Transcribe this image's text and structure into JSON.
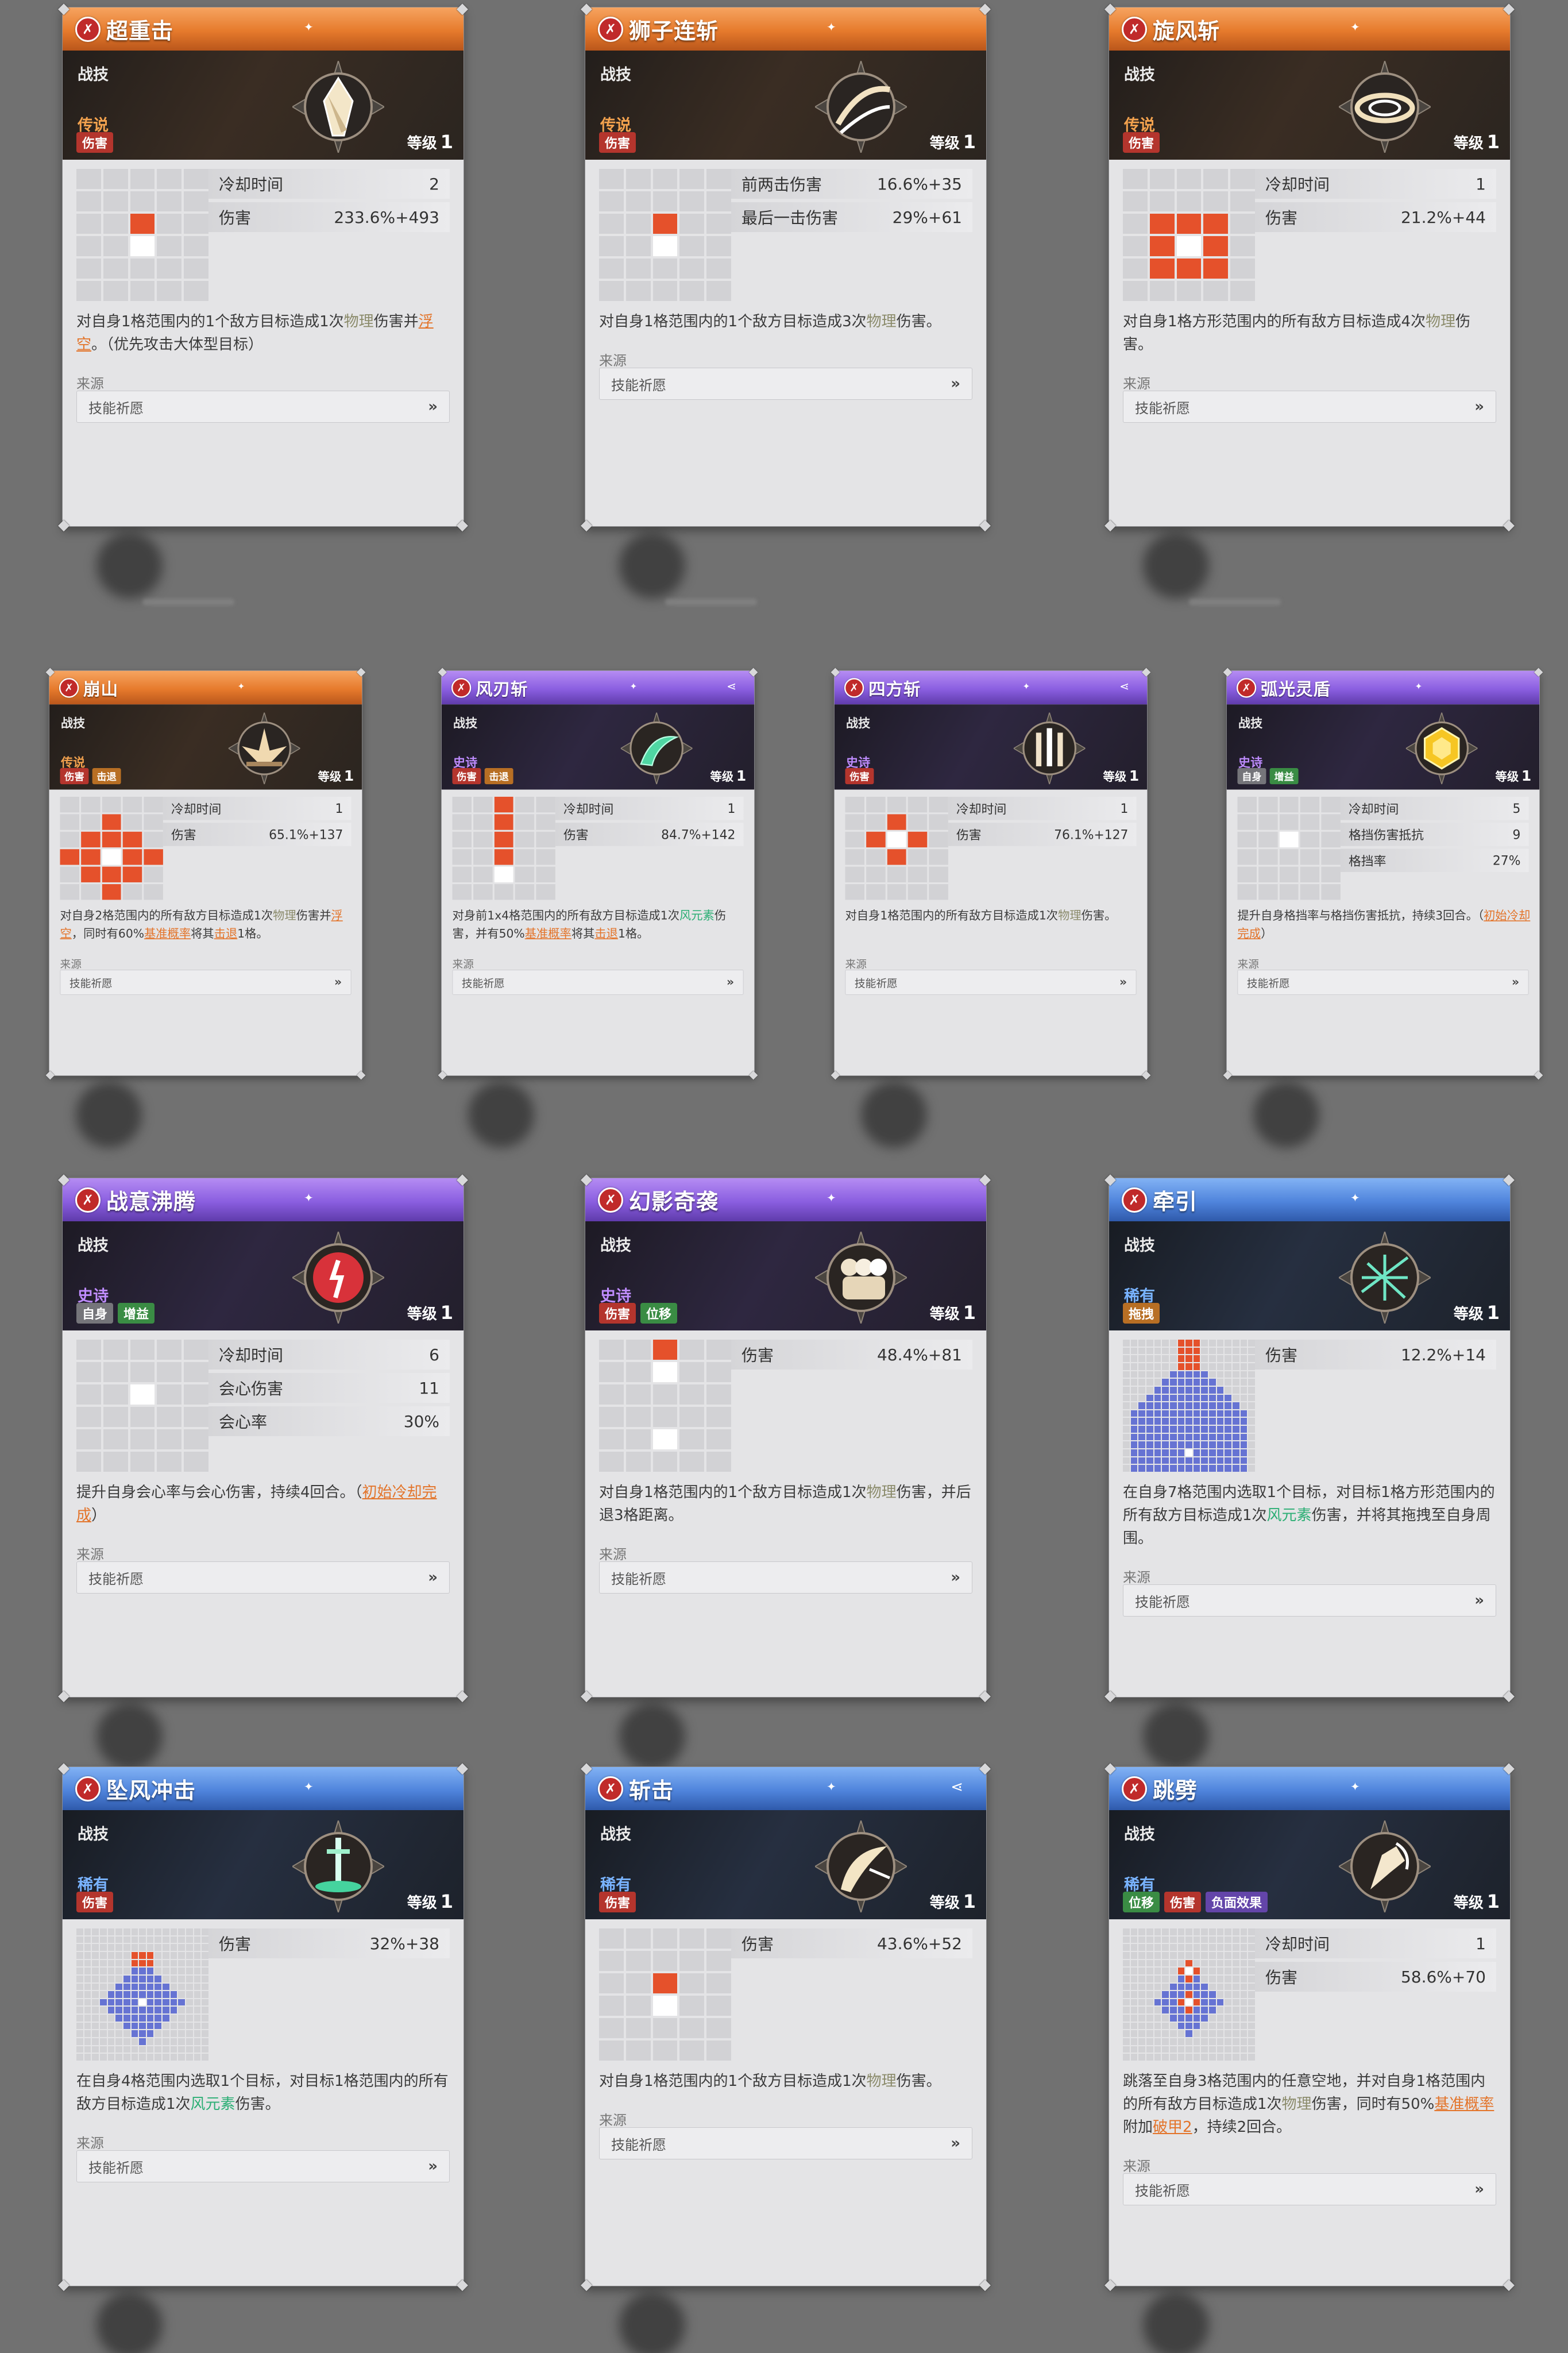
{
  "source_label": "来源",
  "level_label": "等级",
  "source_button_label": "技能祈愿",
  "chevron_glyph": "»",
  "cards": [
    {
      "title": "超重击",
      "type": "战技",
      "rarity": "传说",
      "rarity_key": "legend",
      "level": "1",
      "tags": [
        {
          "label": "伤害",
          "color": "red"
        }
      ],
      "stats": [
        {
          "label": "冷却时间",
          "value": "2"
        },
        {
          "label": "伤害",
          "value": "233.6%+493"
        }
      ],
      "desc": [
        {
          "t": "对自身1格范围内的1个敌方目标造成1次"
        },
        {
          "t": "物理",
          "c": "gray"
        },
        {
          "t": "伤害并"
        },
        {
          "t": "浮空",
          "c": "orange"
        },
        {
          "t": "。（优先攻击大体型目标）"
        }
      ],
      "icon": "crystal-shard-icon",
      "grid": [
        ".....",
        ".....",
        "..r..",
        "..w..",
        ".....",
        "....."
      ]
    },
    {
      "title": "狮子连斩",
      "type": "战技",
      "rarity": "传说",
      "rarity_key": "legend",
      "level": "1",
      "tags": [
        {
          "label": "伤害",
          "color": "red"
        }
      ],
      "stats": [
        {
          "label": "前两击伤害",
          "value": "16.6%+35"
        },
        {
          "label": "最后一击伤害",
          "value": "29%+61"
        }
      ],
      "desc": [
        {
          "t": "对自身1格范围内的1个敌方目标造成3次"
        },
        {
          "t": "物理",
          "c": "gray"
        },
        {
          "t": "伤害。"
        }
      ],
      "icon": "slash-arc-icon",
      "grid": [
        ".....",
        ".....",
        "..r..",
        "..w..",
        ".....",
        "....."
      ]
    },
    {
      "title": "旋风斩",
      "type": "战技",
      "rarity": "传说",
      "rarity_key": "legend",
      "level": "1",
      "tags": [
        {
          "label": "伤害",
          "color": "red"
        }
      ],
      "stats": [
        {
          "label": "冷却时间",
          "value": "1"
        },
        {
          "label": "伤害",
          "value": "21.2%+44"
        }
      ],
      "desc": [
        {
          "t": "对自身1格方形范围内的所有敌方目标造成4次"
        },
        {
          "t": "物理",
          "c": "gray"
        },
        {
          "t": "伤害。"
        }
      ],
      "icon": "whirlwind-icon",
      "grid": [
        ".....",
        ".....",
        ".rrr.",
        ".rwr.",
        ".rrr.",
        "....."
      ]
    },
    {
      "title": "崩山",
      "type": "战技",
      "rarity": "传说",
      "rarity_key": "legend",
      "level": "1",
      "tags": [
        {
          "label": "伤害",
          "color": "red"
        },
        {
          "label": "击退",
          "color": "orange"
        }
      ],
      "stats": [
        {
          "label": "冷却时间",
          "value": "1"
        },
        {
          "label": "伤害",
          "value": "65.1%+137"
        }
      ],
      "desc": [
        {
          "t": "对自身2格范围内的所有敌方目标造成1次"
        },
        {
          "t": "物理",
          "c": "gray"
        },
        {
          "t": "伤害并"
        },
        {
          "t": "浮空",
          "c": "orange"
        },
        {
          "t": "，同时有60%"
        },
        {
          "t": "基准概率",
          "c": "orange"
        },
        {
          "t": "将其"
        },
        {
          "t": "击退",
          "c": "orange"
        },
        {
          "t": "1格。"
        }
      ],
      "icon": "ground-burst-icon",
      "grid": [
        ".....",
        "..r..",
        ".rrr.",
        "rrwrr",
        ".rrr.",
        "..r.."
      ]
    },
    {
      "title": "风刃斩",
      "type": "战技",
      "rarity": "史诗",
      "rarity_key": "epic",
      "level": "1",
      "share": true,
      "tags": [
        {
          "label": "伤害",
          "color": "red"
        },
        {
          "label": "击退",
          "color": "orange"
        }
      ],
      "stats": [
        {
          "label": "冷却时间",
          "value": "1"
        },
        {
          "label": "伤害",
          "value": "84.7%+142"
        }
      ],
      "desc": [
        {
          "t": "对身前1x4格范围内的所有敌方目标造成1次"
        },
        {
          "t": "风元素",
          "c": "green"
        },
        {
          "t": "伤害，并有50%"
        },
        {
          "t": "基准概率",
          "c": "orange"
        },
        {
          "t": "将其"
        },
        {
          "t": "击退",
          "c": "orange"
        },
        {
          "t": "1格。"
        }
      ],
      "icon": "wind-blade-icon",
      "grid": [
        "..r..",
        "..r..",
        "..r..",
        "..r..",
        "..w..",
        "....."
      ]
    },
    {
      "title": "四方斩",
      "type": "战技",
      "rarity": "史诗",
      "rarity_key": "epic",
      "level": "1",
      "share": true,
      "tags": [
        {
          "label": "伤害",
          "color": "red"
        }
      ],
      "stats": [
        {
          "label": "冷却时间",
          "value": "1"
        },
        {
          "label": "伤害",
          "value": "76.1%+127"
        }
      ],
      "desc": [
        {
          "t": "对自身1格范围内的所有敌方目标造成1次"
        },
        {
          "t": "物理",
          "c": "gray"
        },
        {
          "t": "伤害。"
        }
      ],
      "icon": "four-blades-icon",
      "grid": [
        ".....",
        "..r..",
        ".rwr.",
        "..r..",
        ".....",
        "....."
      ]
    },
    {
      "title": "弧光灵盾",
      "type": "战技",
      "rarity": "史诗",
      "rarity_key": "epic",
      "level": "1",
      "tags": [
        {
          "label": "自身",
          "color": "gray"
        },
        {
          "label": "增益",
          "color": "green"
        }
      ],
      "stats": [
        {
          "label": "冷却时间",
          "value": "5"
        },
        {
          "label": "格挡伤害抵抗",
          "value": "9"
        },
        {
          "label": "格挡率",
          "value": "27%"
        }
      ],
      "desc": [
        {
          "t": "提升自身格挡率与格挡伤害抵抗，持续3回合。（"
        },
        {
          "t": "初始冷却完成",
          "c": "orange"
        },
        {
          "t": "）"
        }
      ],
      "icon": "golden-shield-icon",
      "grid": [
        ".....",
        ".....",
        "..w..",
        ".....",
        ".....",
        "....."
      ]
    },
    {
      "title": "战意沸腾",
      "type": "战技",
      "rarity": "史诗",
      "rarity_key": "epic",
      "level": "1",
      "tags": [
        {
          "label": "自身",
          "color": "gray"
        },
        {
          "label": "增益",
          "color": "green"
        }
      ],
      "stats": [
        {
          "label": "冷却时间",
          "value": "6"
        },
        {
          "label": "会心伤害",
          "value": "11"
        },
        {
          "label": "会心率",
          "value": "30%"
        }
      ],
      "desc": [
        {
          "t": "提升自身会心率与会心伤害，持续4回合。（"
        },
        {
          "t": "初始冷却完成",
          "c": "orange"
        },
        {
          "t": "）"
        }
      ],
      "icon": "fury-aura-icon",
      "grid": [
        ".....",
        ".....",
        "..w..",
        ".....",
        ".....",
        "....."
      ]
    },
    {
      "title": "幻影奇袭",
      "type": "战技",
      "rarity": "史诗",
      "rarity_key": "epic",
      "level": "1",
      "tags": [
        {
          "label": "伤害",
          "color": "red"
        },
        {
          "label": "位移",
          "color": "green"
        }
      ],
      "stats": [
        {
          "label": "伤害",
          "value": "48.4%+81"
        }
      ],
      "desc": [
        {
          "t": "对自身1格范围内的1个敌方目标造成1次"
        },
        {
          "t": "物理",
          "c": "gray"
        },
        {
          "t": "伤害，并后退3格距离。"
        }
      ],
      "icon": "phantom-dash-icon",
      "grid": [
        "..r..",
        "..w..",
        ".....",
        ".....",
        "..w..",
        "....."
      ]
    },
    {
      "title": "牵引",
      "type": "战技",
      "rarity": "稀有",
      "rarity_key": "rare",
      "level": "1",
      "tags": [
        {
          "label": "拖拽",
          "color": "orange"
        }
      ],
      "stats": [
        {
          "label": "伤害",
          "value": "12.2%+14"
        }
      ],
      "desc": [
        {
          "t": "在自身7格范围内选取1个目标，对目标1格方形范围内的所有敌方目标造成1次"
        },
        {
          "t": "风元素",
          "c": "green"
        },
        {
          "t": "伤害，并将其拖拽至自身周围。"
        }
      ],
      "icon": "wind-net-icon",
      "grid": "pull"
    },
    {
      "title": "坠风冲击",
      "type": "战技",
      "rarity": "稀有",
      "rarity_key": "rare",
      "level": "1",
      "tags": [
        {
          "label": "伤害",
          "color": "red"
        }
      ],
      "stats": [
        {
          "label": "伤害",
          "value": "32%+38"
        }
      ],
      "desc": [
        {
          "t": "在自身4格范围内选取1个目标，对目标1格范围内的所有敌方目标造成1次"
        },
        {
          "t": "风元素",
          "c": "green"
        },
        {
          "t": "伤害。"
        }
      ],
      "icon": "sword-plunge-icon",
      "grid": "dive"
    },
    {
      "title": "斩击",
      "type": "战技",
      "rarity": "稀有",
      "rarity_key": "rare",
      "level": "1",
      "share": true,
      "tags": [
        {
          "label": "伤害",
          "color": "red"
        }
      ],
      "stats": [
        {
          "label": "伤害",
          "value": "43.6%+52"
        }
      ],
      "desc": [
        {
          "t": "对自身1格范围内的1个敌方目标造成1次"
        },
        {
          "t": "物理",
          "c": "gray"
        },
        {
          "t": "伤害。"
        }
      ],
      "icon": "blade-slash-icon",
      "grid": [
        ".....",
        ".....",
        "..r..",
        "..w..",
        ".....",
        "....."
      ]
    },
    {
      "title": "跳劈",
      "type": "战技",
      "rarity": "稀有",
      "rarity_key": "rare",
      "level": "1",
      "tags": [
        {
          "label": "位移",
          "color": "green"
        },
        {
          "label": "伤害",
          "color": "red"
        },
        {
          "label": "负面效果",
          "color": "purple"
        }
      ],
      "stats": [
        {
          "label": "冷却时间",
          "value": "1"
        },
        {
          "label": "伤害",
          "value": "58.6%+70"
        }
      ],
      "desc": [
        {
          "t": "跳落至自身3格范围内的任意空地，并对自身1格范围内的所有敌方目标造成1次"
        },
        {
          "t": "物理",
          "c": "gray"
        },
        {
          "t": "伤害，同时有50%"
        },
        {
          "t": "基准概率",
          "c": "orange"
        },
        {
          "t": "附加"
        },
        {
          "t": "破甲2",
          "c": "orange"
        },
        {
          "t": "，持续2回合。"
        }
      ],
      "icon": "leap-strike-icon",
      "grid": "leap"
    }
  ]
}
